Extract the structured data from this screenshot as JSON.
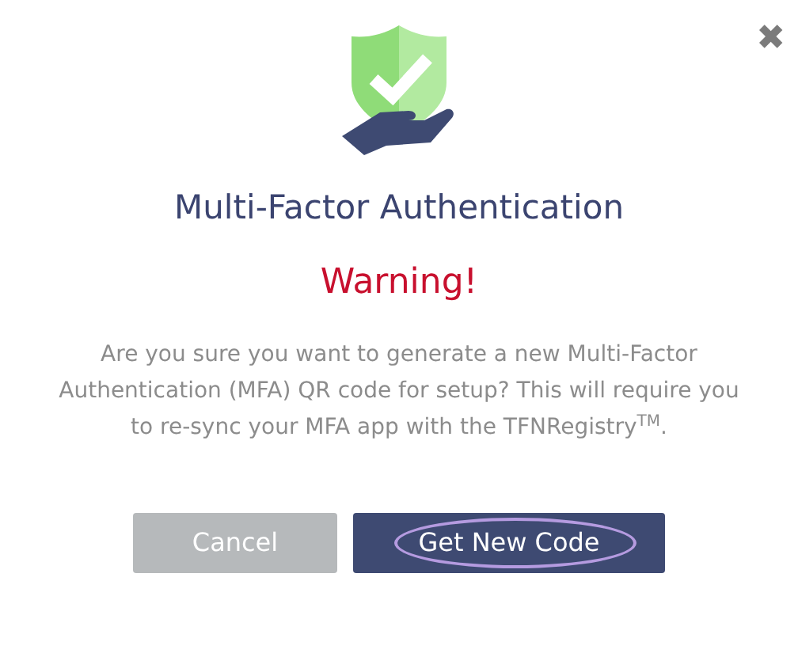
{
  "close_button": {
    "label": "✖"
  },
  "title": "Multi-Factor Authentication",
  "warning": "Warning!",
  "message": "Are you sure you want to generate a new Multi-Factor Authentication (MFA) QR code for setup? This will require you to re-sync your MFA app with the TFNRegistry$^{TM}$.",
  "buttons": [
    {
      "label": "Cancel",
      "kind": "secondary",
      "highlighted": false
    },
    {
      "label": "Get New Code",
      "kind": "primary",
      "highlighted": true
    }
  ]
}
